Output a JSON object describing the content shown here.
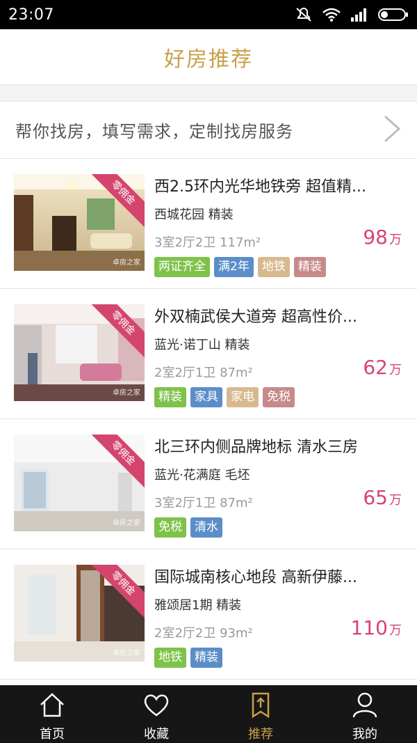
{
  "status": {
    "time": "23:07"
  },
  "header": {
    "title": "好房推荐"
  },
  "find": {
    "text": "帮你找房，填写需求，定制找房服务"
  },
  "colors": {
    "accent_gold": "#c8a048",
    "price_pink": "#d4456e",
    "tag_green": "#7ec24a",
    "tag_blue": "#5b8ec8",
    "tag_beige": "#d8b98f",
    "tag_rose": "#c78a8a"
  },
  "ribbon_text": "零佣金",
  "watermark": "卓房之家",
  "listings": [
    {
      "title": " 西2.5环内光华地铁旁  超值精...",
      "estate": "西城花园 精装",
      "spec": "3室2厅2卫 117m²",
      "price": "98",
      "price_unit": "万",
      "tags": [
        {
          "label": "两证齐全",
          "color": "#7ec24a"
        },
        {
          "label": "满2年",
          "color": "#5b8ec8"
        },
        {
          "label": "地铁",
          "color": "#d8b98f"
        },
        {
          "label": "精装",
          "color": "#c78a8a"
        }
      ]
    },
    {
      "title": "外双楠武侯大道旁  超高性价...",
      "estate": "蓝光·诺丁山 精装",
      "spec": "2室2厅1卫 87m²",
      "price": "62",
      "price_unit": "万",
      "tags": [
        {
          "label": "精装",
          "color": "#7ec24a"
        },
        {
          "label": "家具",
          "color": "#5b8ec8"
        },
        {
          "label": "家电",
          "color": "#d8b98f"
        },
        {
          "label": "免税",
          "color": "#c78a8a"
        }
      ]
    },
    {
      "title": "北三环内侧品牌地标 清水三房",
      "estate": "蓝光·花满庭 毛坯",
      "spec": "3室2厅1卫 87m²",
      "price": "65",
      "price_unit": "万",
      "tags": [
        {
          "label": "免税",
          "color": "#7ec24a"
        },
        {
          "label": "清水",
          "color": "#5b8ec8"
        }
      ]
    },
    {
      "title": "国际城南核心地段 高新伊藤...",
      "estate": "雅颂居1期 精装",
      "spec": "2室2厅2卫 93m²",
      "price": "110",
      "price_unit": "万",
      "tags": [
        {
          "label": "地铁",
          "color": "#7ec24a"
        },
        {
          "label": "精装",
          "color": "#5b8ec8"
        }
      ]
    }
  ],
  "tabs": [
    {
      "label": "首页",
      "icon": "home-icon",
      "active": false
    },
    {
      "label": "收藏",
      "icon": "heart-icon",
      "active": false
    },
    {
      "label": "推荐",
      "icon": "bookmark-up-icon",
      "active": true
    },
    {
      "label": "我的",
      "icon": "person-icon",
      "active": false
    }
  ]
}
